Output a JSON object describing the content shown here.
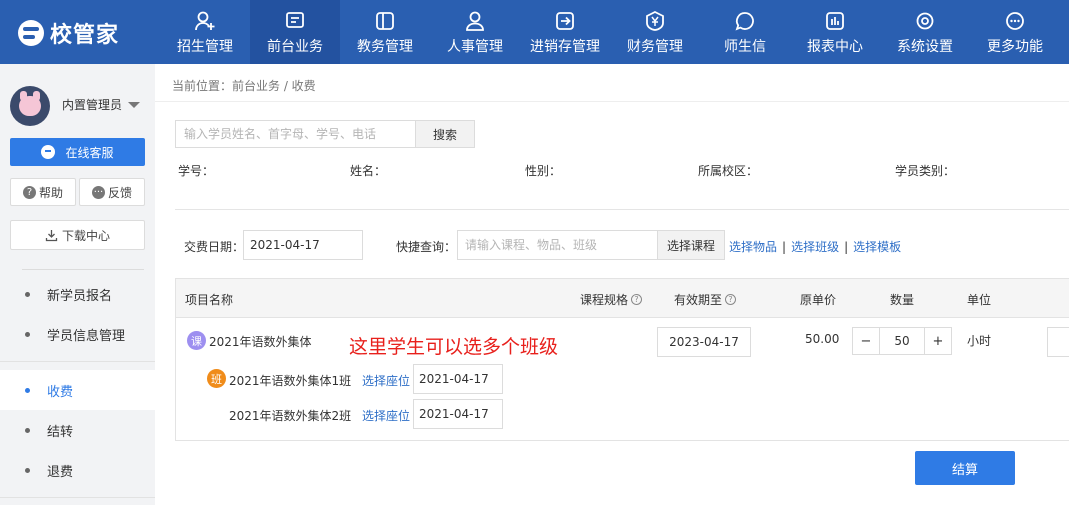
{
  "app": {
    "logo_text": "校管家",
    "brand_color": "#2a5fb1",
    "accent_color": "#2f7be5"
  },
  "nav": {
    "items": [
      {
        "label": "招生管理",
        "icon": "user-plus-icon"
      },
      {
        "label": "前台业务",
        "icon": "desk-icon",
        "active": true
      },
      {
        "label": "教务管理",
        "icon": "book-icon"
      },
      {
        "label": "人事管理",
        "icon": "person-icon"
      },
      {
        "label": "进销存管理",
        "icon": "arrow-box-icon"
      },
      {
        "label": "财务管理",
        "icon": "yen-icon"
      },
      {
        "label": "师生信",
        "icon": "chat-icon"
      },
      {
        "label": "报表中心",
        "icon": "bar-chart-icon"
      },
      {
        "label": "系统设置",
        "icon": "gear-icon"
      },
      {
        "label": "更多功能",
        "icon": "more-icon"
      }
    ]
  },
  "sidebar": {
    "user_name": "内置管理员",
    "online_service": "在线客服",
    "help": "帮助",
    "feedback": "反馈",
    "download_center": "下载中心",
    "menu": [
      {
        "label": "新学员报名"
      },
      {
        "label": "学员信息管理"
      },
      {
        "label": "收费",
        "active": true
      },
      {
        "label": "结转"
      },
      {
        "label": "退费"
      }
    ]
  },
  "breadcrumb": "当前位置：前台业务 / 收费",
  "search": {
    "placeholder": "输入学员姓名、首字母、学号、电话",
    "button": "搜索"
  },
  "student_info": {
    "student_no": "学号：",
    "name": "姓名：",
    "gender": "性别：",
    "campus": "所属校区：",
    "category": "学员类别："
  },
  "fee": {
    "date_label": "交费日期：",
    "date_value": "2021-04-17",
    "quick_label": "快捷查询：",
    "quick_placeholder": "请输入课程、物品、班级",
    "select_course": "选择课程",
    "select_item": "选择物品",
    "select_class": "选择班级",
    "select_template": "选择模板",
    "separator": "|"
  },
  "table": {
    "headers": {
      "item_name": "项目名称",
      "course_spec": "课程规格",
      "valid_until": "有效期至",
      "orig_price": "原单价",
      "quantity": "数量",
      "unit": "单位"
    },
    "course": {
      "badge": "课",
      "name": "2021年语数外集体",
      "valid_until": "2023-04-17",
      "price": "50.00",
      "quantity": "50",
      "unit": "小时"
    },
    "annotation": "这里学生可以选多个班级",
    "classes": [
      {
        "badge": "班",
        "name": "2021年语数外集体1班",
        "seat": "选择座位",
        "date": "2021-04-17"
      },
      {
        "badge": "",
        "name": "2021年语数外集体2班",
        "seat": "选择座位",
        "date": "2021-04-17"
      }
    ]
  },
  "settle_button": "结算"
}
